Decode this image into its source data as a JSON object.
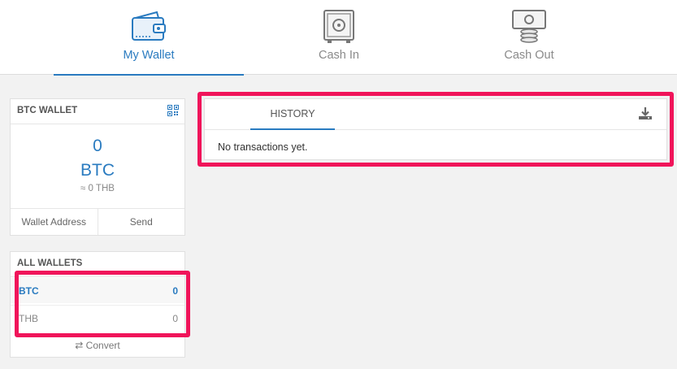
{
  "nav": {
    "items": [
      {
        "label": "My Wallet",
        "icon": "wallet-icon",
        "active": true
      },
      {
        "label": "Cash In",
        "icon": "safe-icon",
        "active": false
      },
      {
        "label": "Cash Out",
        "icon": "cash-stack-icon",
        "active": false
      }
    ]
  },
  "btc_wallet": {
    "title": "BTC WALLET",
    "balance": "0",
    "currency": "BTC",
    "fiat_equiv": "≈ 0 THB",
    "actions": [
      "Wallet Address",
      "Send"
    ]
  },
  "all_wallets": {
    "title": "ALL WALLETS",
    "rows": [
      {
        "name": "BTC",
        "value": "0"
      },
      {
        "name": "THB",
        "value": "0"
      }
    ],
    "convert_label": "⇄ Convert"
  },
  "history": {
    "tab_label": "HISTORY",
    "empty_text": "No transactions yet."
  },
  "colors": {
    "accent": "#2a7bc0",
    "highlight": "#f0145a"
  }
}
